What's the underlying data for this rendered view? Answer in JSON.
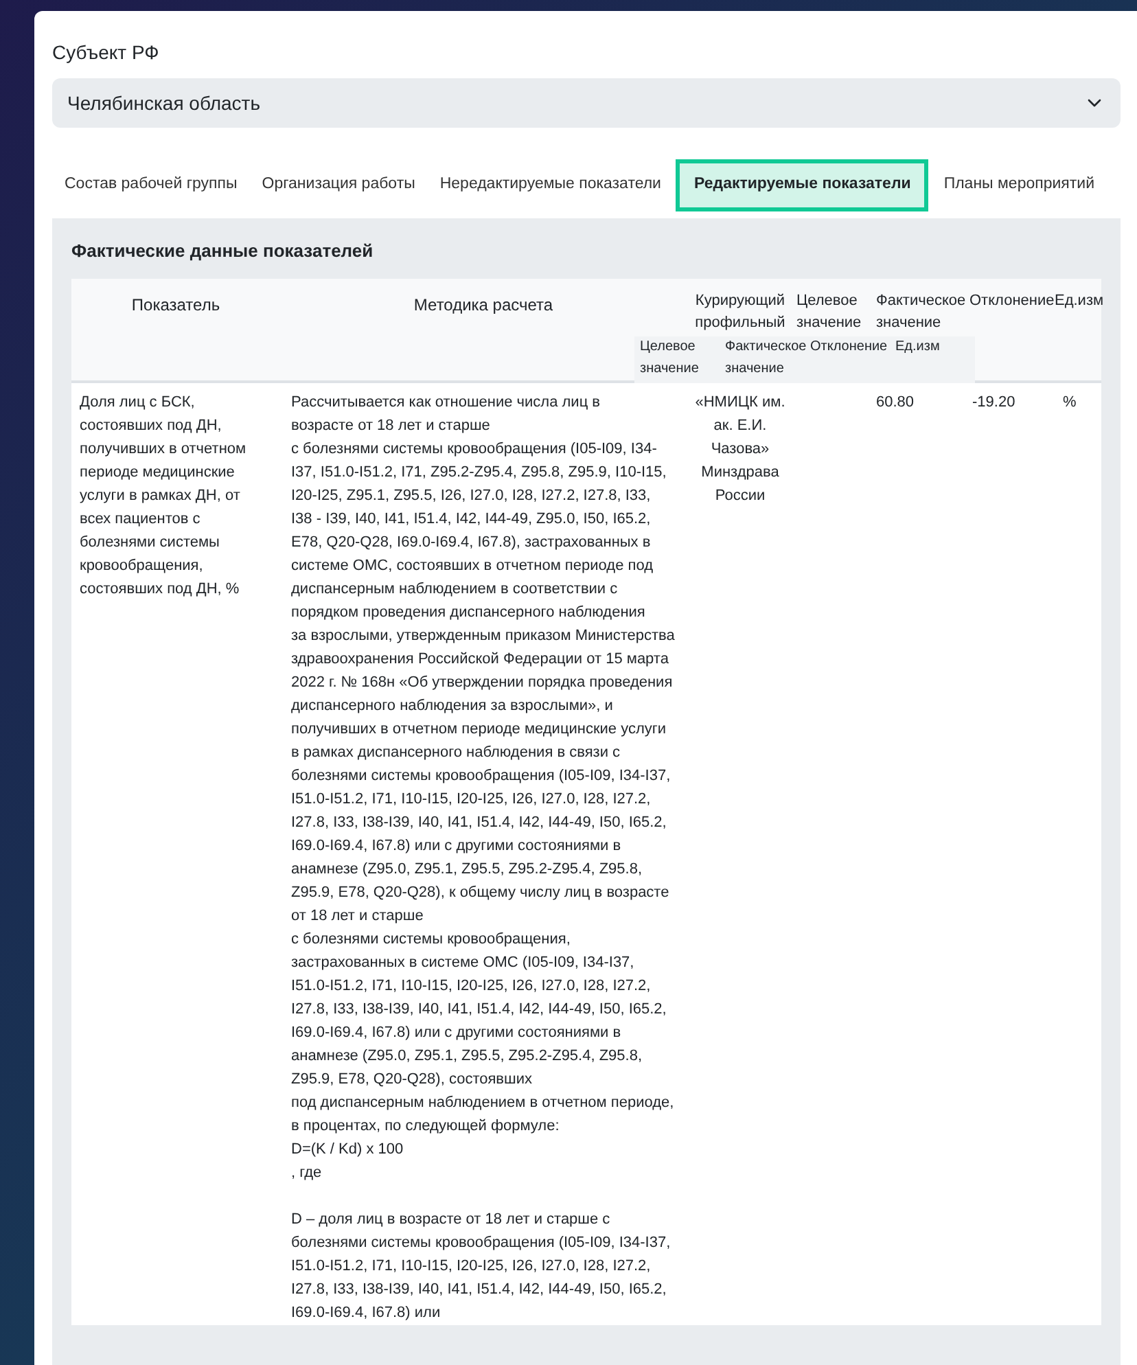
{
  "region": {
    "label": "Субъект РФ",
    "value": "Челябинская область"
  },
  "tabs": [
    {
      "label": "Состав рабочей группы",
      "selected": false
    },
    {
      "label": "Организация работы",
      "selected": false
    },
    {
      "label": "Нередактируемые показатели",
      "selected": false
    },
    {
      "label": "Редактируемые показатели",
      "selected": true
    },
    {
      "label": "Планы мероприятий",
      "selected": false
    }
  ],
  "panel": {
    "title": "Фактические данные показателей",
    "table": {
      "columns": [
        "Показатель",
        "Методика расчета",
        "Курирующий профильный",
        "Целевое значение",
        "Фактическое значение",
        "Отклонение",
        "Ед.изм"
      ],
      "floating_header": [
        "Целевое значение",
        "Фактическое значение",
        "Отклонение",
        "Ед.изм"
      ],
      "rows": [
        {
          "indicator": "Доля лиц с БСК, состоявших под ДН, получивших в отчетном периоде медицинские услуги в рамках ДН, от всех пациентов с болезнями системы кровообращения, состоявших под ДН, %",
          "method": "Рассчитывается как отношение числа лиц в\nвозрасте от 18 лет и старше\nс болезнями системы кровообращения (I05-I09, I34-I37, I51.0-I51.2, I71, Z95.2-Z95.4, Z95.8, Z95.9, I10-I15, I20-I25, Z95.1, Z95.5, I26, I27.0, I28, I27.2, I27.8, I33, I38 - I39, I40, I41, I51.4, I42, I44-49, Z95.0, I50, I65.2, E78, Q20-Q28, I69.0-I69.4, I67.8), застрахованных в системе ОМС, состоявших в отчетном периоде под диспансерным наблюдением в соответствии с порядком проведения диспансерного наблюдения\nза взрослыми, утвержденным приказом Министерства здравоохранения Российской Федерации от 15 марта 2022 г. № 168н «Об утверждении порядка проведения диспансерного наблюдения за взрослыми», и получивших в отчетном периоде медицинские услуги в рамках диспансерного наблюдения в связи с болезнями системы кровообращения (I05-I09, I34-I37, I51.0-I51.2, I71, I10-I15, I20-I25, I26, I27.0, I28, I27.2, I27.8, I33, I38-I39, I40, I41, I51.4, I42, I44-49, I50, I65.2, I69.0-I69.4, I67.8) или с другими состояниями в анамнезе (Z95.0, Z95.1, Z95.5, Z95.2-Z95.4, Z95.8, Z95.9, E78, Q20-Q28), к общему числу лиц в возрасте от 18 лет и старше\nс болезнями системы кровообращения, застрахованных в системе ОМС (I05-I09, I34-I37, I51.0-I51.2, I71, I10-I15, I20-I25, I26, I27.0, I28, I27.2, I27.8, I33, I38-I39, I40, I41, I51.4, I42, I44-49, I50, I65.2, I69.0-I69.4, I67.8) или с другими состояниями в анамнезе (Z95.0, Z95.1, Z95.5, Z95.2-Z95.4, Z95.8, Z95.9, E78, Q20-Q28), состоявших\nпод диспансерным наблюдением в отчетном периоде, в процентах, по следующей формуле:\nD=(K / Kd) x 100\n, где\n\nD – доля лиц в возрасте от 18 лет и старше с болезнями системы кровообращения (I05-I09, I34-I37, I51.0-I51.2, I71, I10-I15, I20-I25, I26, I27.0, I28, I27.2, I27.8, I33, I38-I39, I40, I41, I51.4, I42, I44-49, I50, I65.2, I69.0-I69.4, I67.8) или",
          "curator": "«НМИЦК им. ак. Е.И. Чазова» Минздрава России",
          "actual": "60.80",
          "deviation": "-19.20",
          "unit": "%"
        }
      ]
    }
  }
}
